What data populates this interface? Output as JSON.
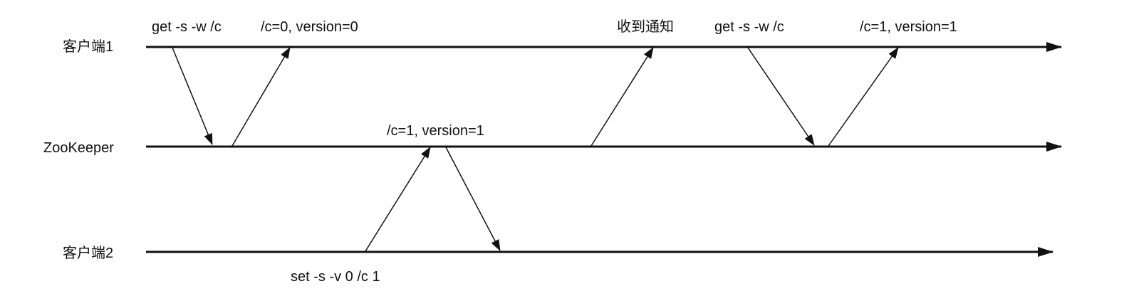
{
  "lanes": {
    "client1": "客户端1",
    "zookeeper": "ZooKeeper",
    "client2": "客户端2"
  },
  "messages": {
    "get_watch_1": "get -s -w /c",
    "resp_v0": "/c=0, version=0",
    "notify": "收到通知",
    "get_watch_2": "get -s -w /c",
    "resp_v1_client": "/c=1, version=1",
    "zk_state_v1": "/c=1, version=1",
    "set_cmd": "set -s -v 0  /c 1"
  },
  "colors": {
    "line": "#111111",
    "background": "#ffffff"
  }
}
